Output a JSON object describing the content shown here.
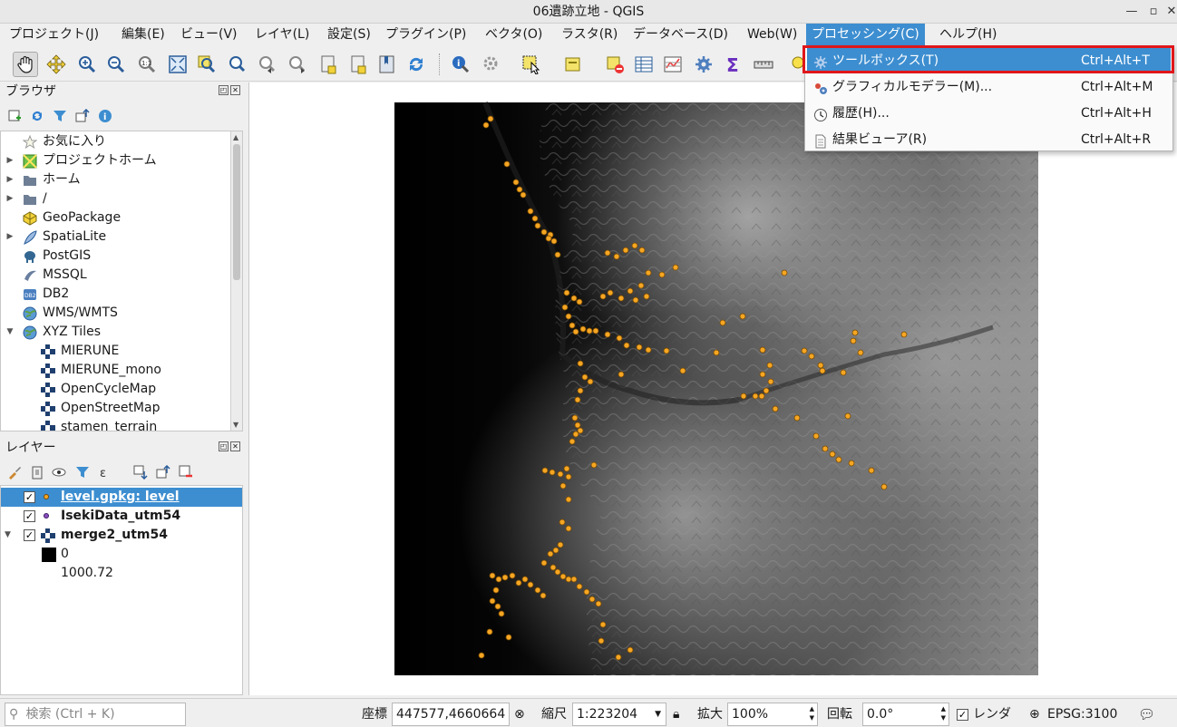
{
  "window": {
    "title": "06遺跡立地 - QGIS"
  },
  "menubar": {
    "items": [
      "プロジェクト(J)",
      "編集(E)",
      "ビュー(V)",
      "レイヤ(L)",
      "設定(S)",
      "プラグイン(P)",
      "ベクタ(O)",
      "ラスタ(R)",
      "データベース(D)",
      "Web(W)",
      "プロセッシング(C)",
      "ヘルプ(H)"
    ],
    "active": "プロセッシング(C)"
  },
  "processing_menu": {
    "items": [
      {
        "label": "ツールボックス(T)",
        "shortcut": "Ctrl+Alt+T",
        "icon": "gear-icon",
        "highlighted": true
      },
      {
        "label": "グラフィカルモデラー(M)...",
        "shortcut": "Ctrl+Alt+M",
        "icon": "gears-icon",
        "highlighted": false
      },
      {
        "label": "履歴(H)...",
        "shortcut": "Ctrl+Alt+H",
        "icon": "clock-icon",
        "highlighted": false
      },
      {
        "label": "結果ビューア(R)",
        "shortcut": "Ctrl+Alt+R",
        "icon": "document-icon",
        "highlighted": false
      }
    ]
  },
  "browser_panel": {
    "title": "ブラウザ",
    "items": [
      {
        "label": "お気に入り",
        "icon": "star-icon",
        "expander": ""
      },
      {
        "label": "プロジェクトホーム",
        "icon": "project-home-icon",
        "expander": "▶"
      },
      {
        "label": "ホーム",
        "icon": "folder-icon",
        "expander": "▶"
      },
      {
        "label": "/",
        "icon": "folder-icon",
        "expander": "▶"
      },
      {
        "label": "GeoPackage",
        "icon": "geopackage-icon",
        "expander": ""
      },
      {
        "label": "SpatiaLite",
        "icon": "feather-icon",
        "expander": "▶"
      },
      {
        "label": "PostGIS",
        "icon": "elephant-icon",
        "expander": ""
      },
      {
        "label": "MSSQL",
        "icon": "mssql-icon",
        "expander": ""
      },
      {
        "label": "DB2",
        "icon": "db2-icon",
        "expander": ""
      },
      {
        "label": "WMS/WMTS",
        "icon": "globe-icon",
        "expander": ""
      },
      {
        "label": "XYZ Tiles",
        "icon": "globe-icon",
        "expander": "▼"
      },
      {
        "label": "MIERUNE",
        "icon": "tiles-icon",
        "expander": "",
        "child": true
      },
      {
        "label": "MIERUNE_mono",
        "icon": "tiles-icon",
        "expander": "",
        "child": true
      },
      {
        "label": "OpenCycleMap",
        "icon": "tiles-icon",
        "expander": "",
        "child": true
      },
      {
        "label": "OpenStreetMap",
        "icon": "tiles-icon",
        "expander": "",
        "child": true
      },
      {
        "label": "stamen_terrain",
        "icon": "tiles-icon",
        "expander": "",
        "child": true
      }
    ]
  },
  "layers_panel": {
    "title": "レイヤー",
    "layers": [
      {
        "label": "level.gpkg: level",
        "checked": true,
        "selected": true,
        "symbol": "orange-point",
        "expander": ""
      },
      {
        "label": "IsekiData_utm54",
        "checked": true,
        "selected": false,
        "symbol": "purple-point",
        "expander": ""
      },
      {
        "label": "merge2_utm54",
        "checked": true,
        "selected": false,
        "symbol": "raster",
        "expander": "▼"
      }
    ],
    "legend": {
      "min": "0",
      "max": "1000.72"
    }
  },
  "statusbar": {
    "search_placeholder": "検索 (Ctrl + K)",
    "coordinate_label": "座標",
    "coordinate": "447577,4660664",
    "scale_label": "縮尺",
    "scale": "1:223204",
    "magnifier_label": "拡大",
    "magnifier": "100%",
    "rotation_label": "回転",
    "rotation": "0.0°",
    "render_label": "レンダ",
    "render_checked": true,
    "crs": "EPSG:3100"
  },
  "colors": {
    "accent": "#3d8ed0",
    "highlight_border": "#e0161a",
    "point_fill": "#f5a623"
  }
}
